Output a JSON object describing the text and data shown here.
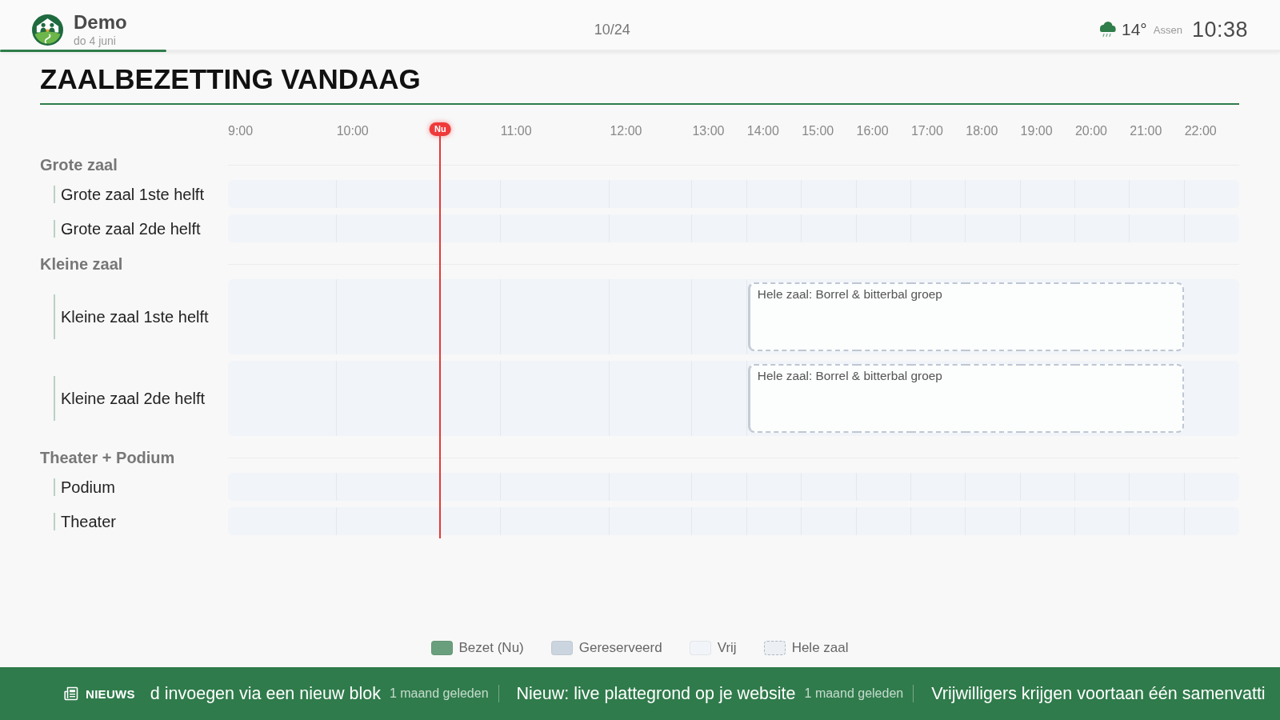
{
  "header": {
    "title": "Demo",
    "date": "do 4 juni",
    "page_counter": "10/24",
    "progress": {
      "level": 0.13
    },
    "weather": {
      "temperature": "14°",
      "location": "Assen"
    },
    "clock": "10:38"
  },
  "heading": "ZAALBEZETTING VANDAAG",
  "timeline": {
    "hours": [
      "9:00",
      "10:00",
      "11:00",
      "12:00",
      "13:00",
      "14:00",
      "15:00",
      "16:00",
      "17:00",
      "18:00",
      "19:00",
      "20:00",
      "21:00",
      "22:00"
    ],
    "now_marker": {
      "label": "Nu",
      "level": 0.21
    },
    "groups": [
      {
        "name": "Grote zaal",
        "rooms": [
          {
            "name": "Grote zaal 1ste helft"
          },
          {
            "name": "Grote zaal 2de helft"
          }
        ]
      },
      {
        "name": "Kleine zaal",
        "rooms": [
          {
            "name": "Kleine zaal 1ste helft",
            "booking": {
              "kind": "whole_room",
              "label": "Hele zaal: Borrel & bitterbal groep"
            },
            "slots": [
              {
                "booked": false
              },
              {
                "booked": false
              },
              {
                "booked": false
              },
              {
                "booked": false
              },
              {
                "booked": false
              },
              {
                "booked": true
              },
              {
                "booked": true
              },
              {
                "booked": true
              },
              {
                "booked": true
              },
              {
                "booked": true
              },
              {
                "booked": true
              },
              {
                "booked": true
              },
              {
                "booked": true
              },
              {
                "booked": false
              }
            ]
          },
          {
            "name": "Kleine zaal 2de helft",
            "booking": {
              "kind": "whole_room",
              "label": "Hele zaal: Borrel & bitterbal groep"
            },
            "slots": [
              {
                "booked": false
              },
              {
                "booked": false
              },
              {
                "booked": false
              },
              {
                "booked": false
              },
              {
                "booked": false
              },
              {
                "booked": true
              },
              {
                "booked": true
              },
              {
                "booked": true
              },
              {
                "booked": true
              },
              {
                "booked": true
              },
              {
                "booked": true
              },
              {
                "booked": true
              },
              {
                "booked": true
              },
              {
                "booked": false
              }
            ]
          }
        ]
      },
      {
        "name": "Theater + Podium",
        "rooms": [
          {
            "name": "Podium"
          },
          {
            "name": "Theater"
          }
        ]
      }
    ]
  },
  "legend": [
    {
      "label": "Bezet (Nu)",
      "kind": "solid",
      "color": "#6a9f7e"
    },
    {
      "label": "Gereserveerd",
      "kind": "solid",
      "color": "#cbd5e0"
    },
    {
      "label": "Vrij",
      "kind": "solid",
      "color": "#f1f4f8"
    },
    {
      "label": "Hele zaal",
      "kind": "dashed",
      "color": "#eceff3"
    }
  ],
  "news": {
    "label": "NIEUWS",
    "items": [
      {
        "title": "d invoegen via een nieuw blok",
        "age": "1 maand geleden"
      },
      {
        "title": "Nieuw: live plattegrond op je website",
        "age": "1 maand geleden"
      },
      {
        "title": "Vrijwilligers krijgen voortaan één samenvatti"
      }
    ]
  }
}
